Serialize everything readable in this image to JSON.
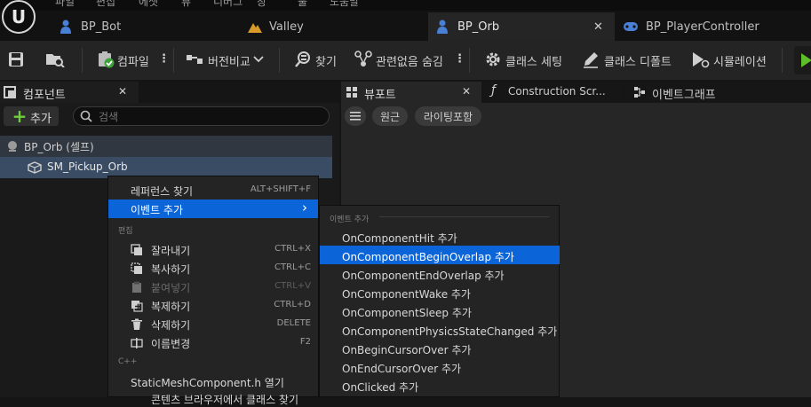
{
  "menubar": {
    "items": [
      "파일",
      "편집",
      "에셋",
      "뷰",
      "디버그",
      "창",
      "툴",
      "도움말"
    ]
  },
  "tabs": [
    {
      "label": "BP_Bot"
    },
    {
      "label": "Valley"
    },
    {
      "label": "BP_Orb",
      "close": "✕"
    },
    {
      "label": "BP_PlayerController"
    }
  ],
  "toolbar": {
    "compile": "컴파일",
    "diff": "버전비교",
    "find": "찾기",
    "hide_unrelated": "관련없음 숨김",
    "class_settings": "클래스 세팅",
    "class_defaults": "클래스 디폴트",
    "simulation": "시뮬레이션"
  },
  "components": {
    "title": "컴포넌트",
    "close": "✕",
    "add": "추가",
    "search_placeholder": "검색",
    "tree": [
      {
        "label": "BP_Orb (셀프)"
      },
      {
        "label": "SM_Pickup_Orb"
      }
    ]
  },
  "right_tabs": {
    "viewport": "뷰포트",
    "close": "✕",
    "construction": "Construction Scr...",
    "event_graph": "이벤트그래프"
  },
  "viewport": {
    "perspective": "원근",
    "lighting": "라이팅포함"
  },
  "context_menu": {
    "find_refs": {
      "label": "레퍼런스 찾기",
      "shortcut": "ALT+SHIFT+F"
    },
    "add_event": {
      "label": "이벤트 추가",
      "arrow": "›"
    },
    "edit_section": "편집",
    "cut": {
      "label": "잘라내기",
      "shortcut": "CTRL+X"
    },
    "copy": {
      "label": "복사하기",
      "shortcut": "CTRL+C"
    },
    "paste": {
      "label": "붙여넣기",
      "shortcut": "CTRL+V"
    },
    "duplicate": {
      "label": "복제하기",
      "shortcut": "CTRL+D"
    },
    "delete": {
      "label": "삭제하기",
      "shortcut": "DELETE"
    },
    "rename": {
      "label": "이름변경",
      "shortcut": "F2"
    },
    "cpp_section": "C++",
    "open_header": "StaticMeshComponent.h 열기",
    "partial": "콘텐츠 브라우저에서 클래스 찾기"
  },
  "submenu": {
    "section": "이벤트 추가",
    "items": [
      "OnComponentHit 추가",
      "OnComponentBeginOverlap 추가",
      "OnComponentEndOverlap 추가",
      "OnComponentWake 추가",
      "OnComponentSleep 추가",
      "OnComponentPhysicsStateChanged 추가",
      "OnBeginCursorOver 추가",
      "OnEndCursorOver 추가",
      "OnClicked 추가"
    ]
  },
  "colors": {
    "accent": "#0b64d8",
    "add_green": "#6fcf3a",
    "play_green": "#5fbf2a"
  }
}
